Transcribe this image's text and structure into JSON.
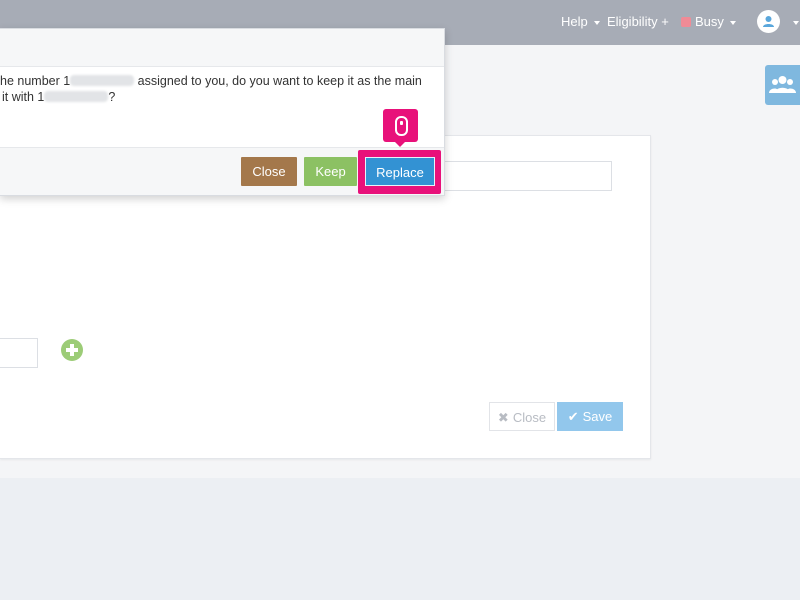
{
  "navbar": {
    "help_label": "Help",
    "eligibility_label": "Eligibility",
    "eligibility_plus": "+",
    "status_label": "Busy",
    "status_color": "#f08b96",
    "avatar_icon": "user-icon"
  },
  "sidebar_right": {
    "team_icon": "users-group-icon"
  },
  "modal": {
    "message_line1_prefix": "he number 1",
    "message_line1_suffix": "assigned to you, do you want to keep it as the main",
    "message_line2_prefix": "it with 1",
    "message_line2_suffix": "?",
    "close_label": "Close",
    "keep_label": "Keep",
    "replace_label": "Replace",
    "colors": {
      "close": "#a4784b",
      "keep": "#8cc163",
      "replace": "#3392d3",
      "highlight": "#e8117a"
    }
  },
  "form": {
    "close_label": "Close",
    "save_label": "Save",
    "close_icon": "times-icon",
    "save_icon": "check-circle-icon",
    "add_icon": "plus-circle-icon"
  }
}
